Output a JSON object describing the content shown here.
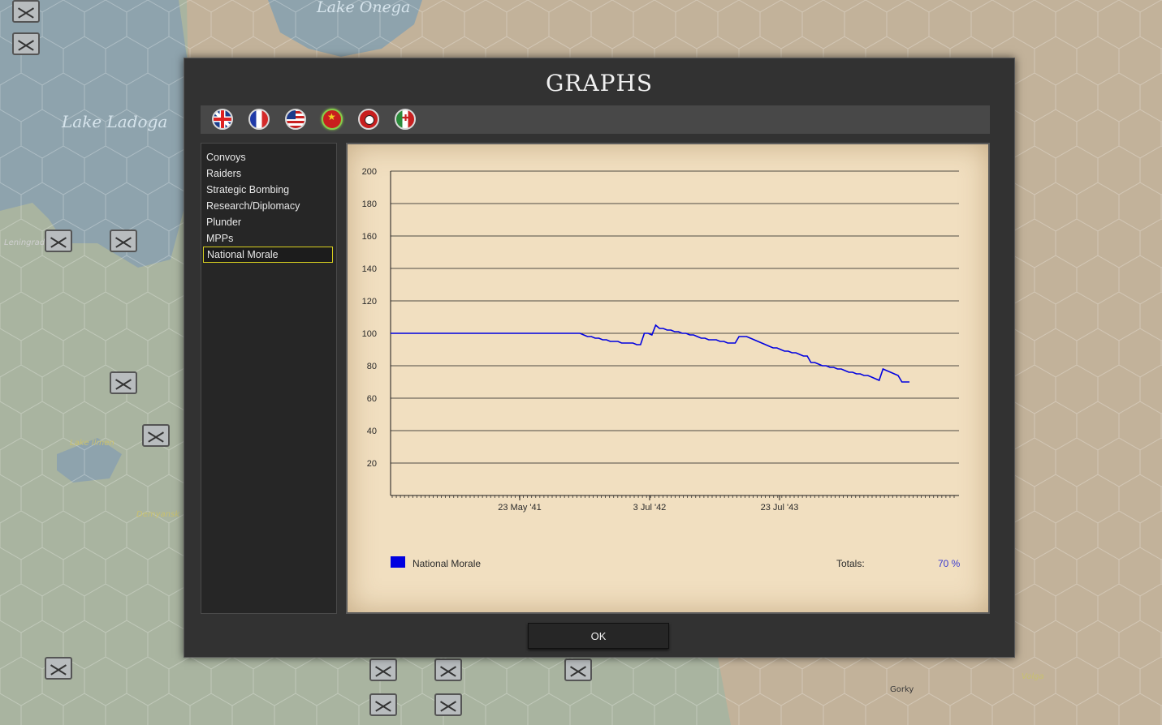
{
  "map": {
    "lakes": [
      "Lake Ladoga",
      "Lake Onega"
    ],
    "towns": [
      "Leningrad",
      "Lake Ilmen",
      "Demyansk",
      "Gorky",
      "Volga"
    ],
    "colors": {
      "water": "#8ea3ad",
      "land": "#a9b4a0",
      "steppe": "#c2b29a"
    }
  },
  "dialog": {
    "title": "GRAPHS",
    "flags": [
      {
        "nation": "United Kingdom",
        "icon": "uk-flag-icon"
      },
      {
        "nation": "France",
        "icon": "france-flag-icon"
      },
      {
        "nation": "United States",
        "icon": "usa-flag-icon"
      },
      {
        "nation": "China",
        "icon": "china-flag-icon",
        "selected": true
      },
      {
        "nation": "Germany",
        "icon": "germany-flag-icon"
      },
      {
        "nation": "Italy",
        "icon": "italy-flag-icon"
      }
    ],
    "graph_types": [
      "Convoys",
      "Raiders",
      "Strategic Bombing",
      "Research/Diplomacy",
      "Plunder",
      "MPPs",
      "National Morale"
    ],
    "selected_graph": "National Morale",
    "totals_label": "Totals:",
    "totals_value": "70 %",
    "ok_label": "OK"
  },
  "chart_data": {
    "type": "line",
    "ylim": [
      0,
      200
    ],
    "y_ticks": [
      20,
      40,
      60,
      80,
      100,
      120,
      140,
      160,
      180,
      200
    ],
    "x_tick_labels": [
      "23 May '41",
      "3 Jul '42",
      "23 Jul '43"
    ],
    "legend_position": "bottom-left",
    "grid": true,
    "series": [
      {
        "name": "National Morale",
        "color": "#0000e0",
        "values": [
          100,
          100,
          100,
          100,
          100,
          100,
          100,
          100,
          100,
          100,
          100,
          100,
          100,
          100,
          100,
          100,
          100,
          100,
          100,
          100,
          100,
          100,
          100,
          100,
          100,
          100,
          100,
          100,
          100,
          100,
          100,
          100,
          100,
          100,
          100,
          100,
          100,
          100,
          100,
          100,
          100,
          100,
          100,
          100,
          100,
          100,
          100,
          100,
          100,
          100,
          100,
          99,
          98,
          98,
          97,
          97,
          96,
          96,
          95,
          95,
          95,
          94,
          94,
          94,
          94,
          93,
          93,
          100,
          100,
          99,
          105,
          103,
          103,
          102,
          102,
          101,
          101,
          100,
          100,
          99,
          99,
          98,
          97,
          97,
          96,
          96,
          96,
          95,
          95,
          94,
          94,
          94,
          98,
          98,
          98,
          97,
          96,
          95,
          94,
          93,
          92,
          91,
          91,
          90,
          89,
          89,
          88,
          88,
          87,
          86,
          86,
          82,
          82,
          81,
          80,
          80,
          79,
          79,
          78,
          78,
          77,
          76,
          76,
          75,
          75,
          74,
          74,
          73,
          72,
          71,
          78,
          77,
          76,
          75,
          74,
          70,
          70,
          70
        ]
      }
    ]
  }
}
